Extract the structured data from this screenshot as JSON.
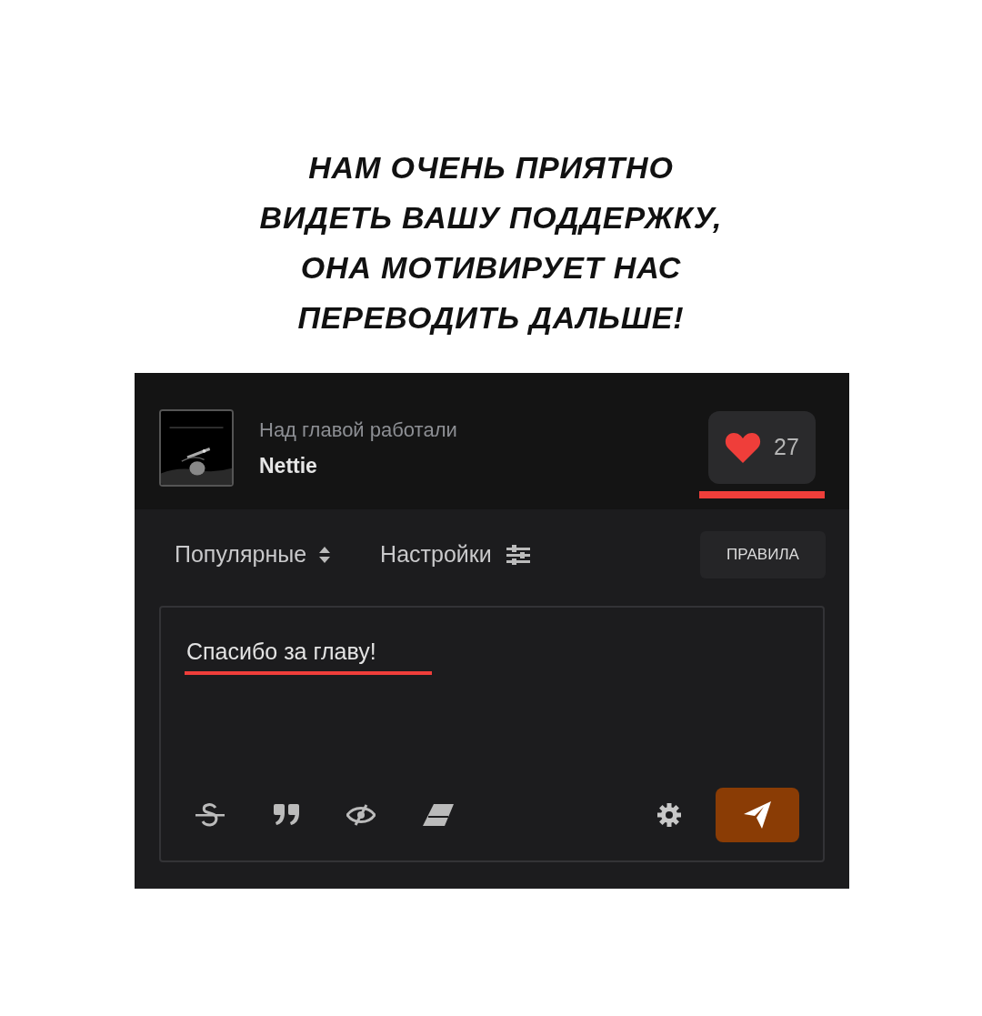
{
  "heading": [
    "НАМ ОЧЕНЬ ПРИЯТНО",
    "ВИДЕТЬ ВАШУ ПОДДЕРЖКУ,",
    "ОНА МОТИВИРУЕТ НАС",
    "ПЕРЕВОДИТЬ ДАЛЬШЕ!"
  ],
  "credits": {
    "caption": "Над главой работали",
    "name": "Nettie"
  },
  "like": {
    "count": "27",
    "highlighted": true
  },
  "toolbar": {
    "sort": "Популярные",
    "settings": "Настройки",
    "rules": "ПРАВИЛА"
  },
  "comment": {
    "value": "Спасибо за главу!",
    "highlighted": true
  }
}
